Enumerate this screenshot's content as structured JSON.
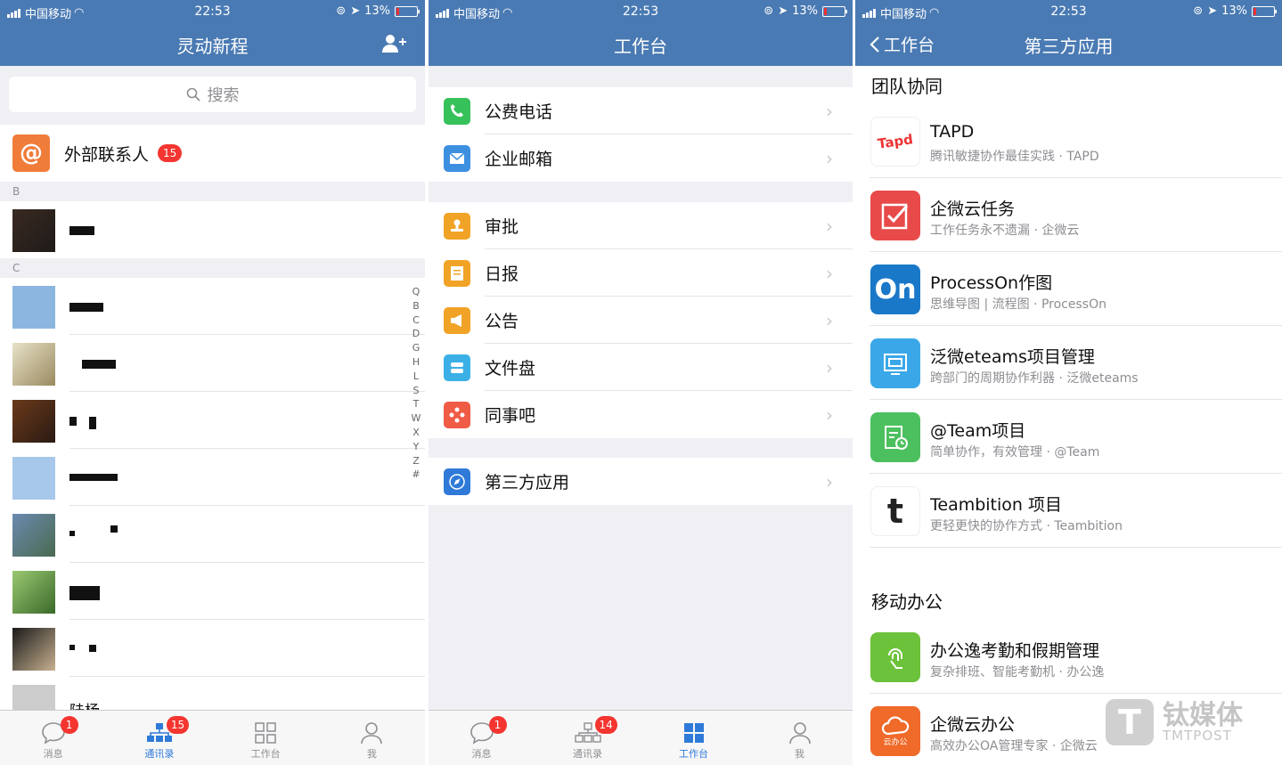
{
  "status": {
    "carrier": "中国移动",
    "time": "22:53",
    "battery": "13%"
  },
  "contacts": {
    "title": "灵动新程",
    "search_placeholder": "搜索",
    "external": {
      "label": "外部联系人",
      "badge": "15"
    },
    "sections": [
      "B",
      "C"
    ],
    "partial_name": "陆杨",
    "index": [
      "Q",
      "B",
      "C",
      "D",
      "G",
      "H",
      "L",
      "S",
      "T",
      "W",
      "X",
      "Y",
      "Z",
      "#"
    ]
  },
  "workbench": {
    "title": "工作台",
    "group1": [
      "公费电话",
      "企业邮箱"
    ],
    "group2": [
      "审批",
      "日报",
      "公告",
      "文件盘",
      "同事吧"
    ],
    "group3": [
      "第三方应用"
    ]
  },
  "third_party": {
    "back": "工作台",
    "title": "第三方应用",
    "group1_title": "团队协同",
    "group1": [
      {
        "name": "TAPD",
        "desc": "腾讯敏捷协作最佳实践 · TAPD",
        "icon": "tapd-icon"
      },
      {
        "name": "企微云任务",
        "desc": "工作任务永不遗漏 · 企微云",
        "icon": "checkbox-icon"
      },
      {
        "name": "ProcessOn作图",
        "desc": "思维导图 | 流程图 · ProcessOn",
        "icon": "processon-icon"
      },
      {
        "name": "泛微eteams项目管理",
        "desc": "跨部门的周期协作利器 · 泛微eteams",
        "icon": "eteams-icon"
      },
      {
        "name": "@Team项目",
        "desc": "简单协作，有效管理 · @Team",
        "icon": "clipboard-clock-icon"
      },
      {
        "name": "Teambition 项目",
        "desc": "更轻更快的协作方式 · Teambition",
        "icon": "teambition-icon"
      }
    ],
    "group2_title": "移动办公",
    "group2": [
      {
        "name": "办公逸考勤和假期管理",
        "desc": "复杂排班、智能考勤机 · 办公逸",
        "icon": "fingerprint-icon"
      },
      {
        "name": "企微云办公",
        "desc": "高效办公OA管理专家 · 企微云",
        "icon": "cloud-icon"
      }
    ],
    "cloud_icon_text": "云办公"
  },
  "tabs": {
    "messages": "消息",
    "contacts": "通讯录",
    "workbench": "工作台",
    "me": "我",
    "msg_badge": "1",
    "contacts_badge_p1": "15",
    "contacts_badge_p2": "14"
  },
  "watermark": {
    "cn": "钛媒体",
    "en": "TMTPOST",
    "logo": "T"
  },
  "colors": {
    "nav": "#4a7ab3",
    "accent": "#2f7ad8",
    "badge": "#f43530"
  }
}
